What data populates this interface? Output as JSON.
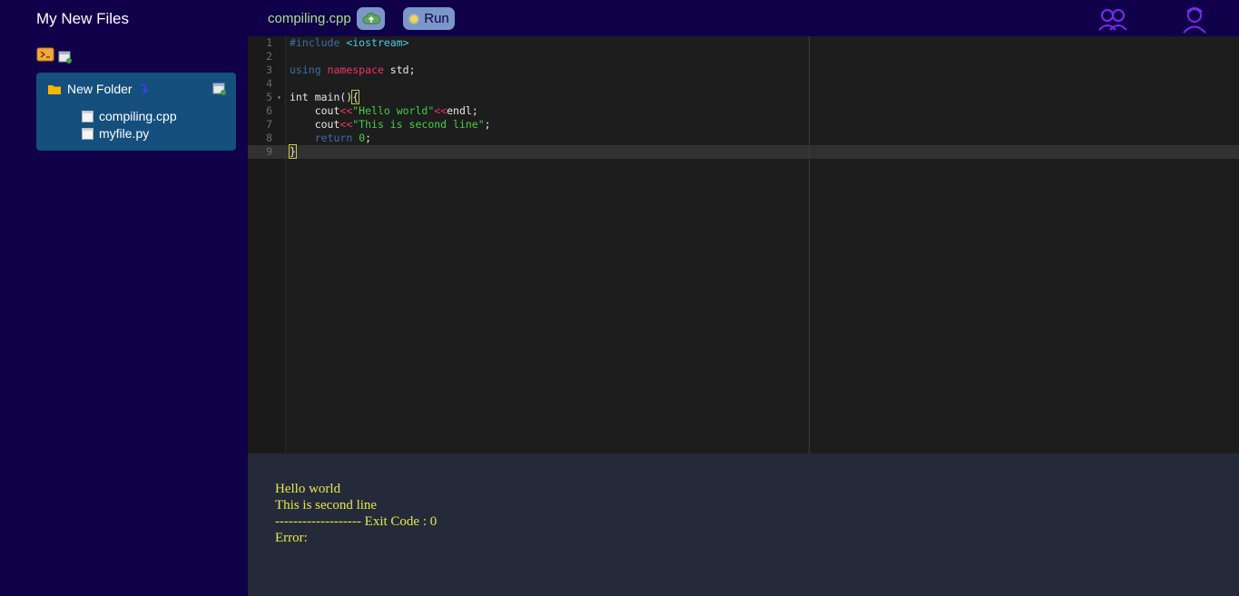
{
  "app": {
    "title": "My New Files"
  },
  "topbar": {
    "filename": "compiling.cpp",
    "run_label": "Run",
    "save_icon": "cloud-upload-icon"
  },
  "sidebar": {
    "folder": {
      "name": "New Folder"
    },
    "files": [
      {
        "name": "compiling.cpp"
      },
      {
        "name": "myfile.py"
      }
    ]
  },
  "editor": {
    "line_numbers": [
      "1",
      "2",
      "3",
      "4",
      "5",
      "6",
      "7",
      "8",
      "9"
    ],
    "lines": [
      "#include <iostream>",
      "",
      "using namespace std;",
      "",
      "int main(){",
      "    cout<<\"Hello world\"<<endl;",
      "    cout<<\"This is second line\";",
      "    return 0;",
      "}"
    ],
    "tokens": {
      "l1_directive": "#include",
      "l1_header": "<iostream>",
      "l3_using": "using",
      "l3_namespace": "namespace",
      "l3_rest": " std;",
      "l5_sig": "int main()",
      "l5_brace": "{",
      "l6_cout": "    cout",
      "l6_op1": "<<",
      "l6_str": "\"Hello world\"",
      "l6_op2": "<<",
      "l6_rest": "endl;",
      "l7_cout": "    cout",
      "l7_op": "<<",
      "l7_str": "\"This is second line\"",
      "l7_rest": ";",
      "l8_indent": "    ",
      "l8_return": "return",
      "l8_num": "0",
      "l8_rest": ";",
      "l9_brace": "}"
    }
  },
  "console": {
    "lines": [
      "Hello world",
      "This is second line",
      "------------------- Exit Code : 0",
      "Error:"
    ]
  },
  "colors": {
    "background": "#10004a",
    "folder_panel": "#154f7e",
    "editor_bg": "#1d1d1d",
    "console_bg": "#252a3a",
    "console_text": "#e5e84a",
    "filename_green": "#a9e08b",
    "button_bg": "#7b96c8"
  }
}
